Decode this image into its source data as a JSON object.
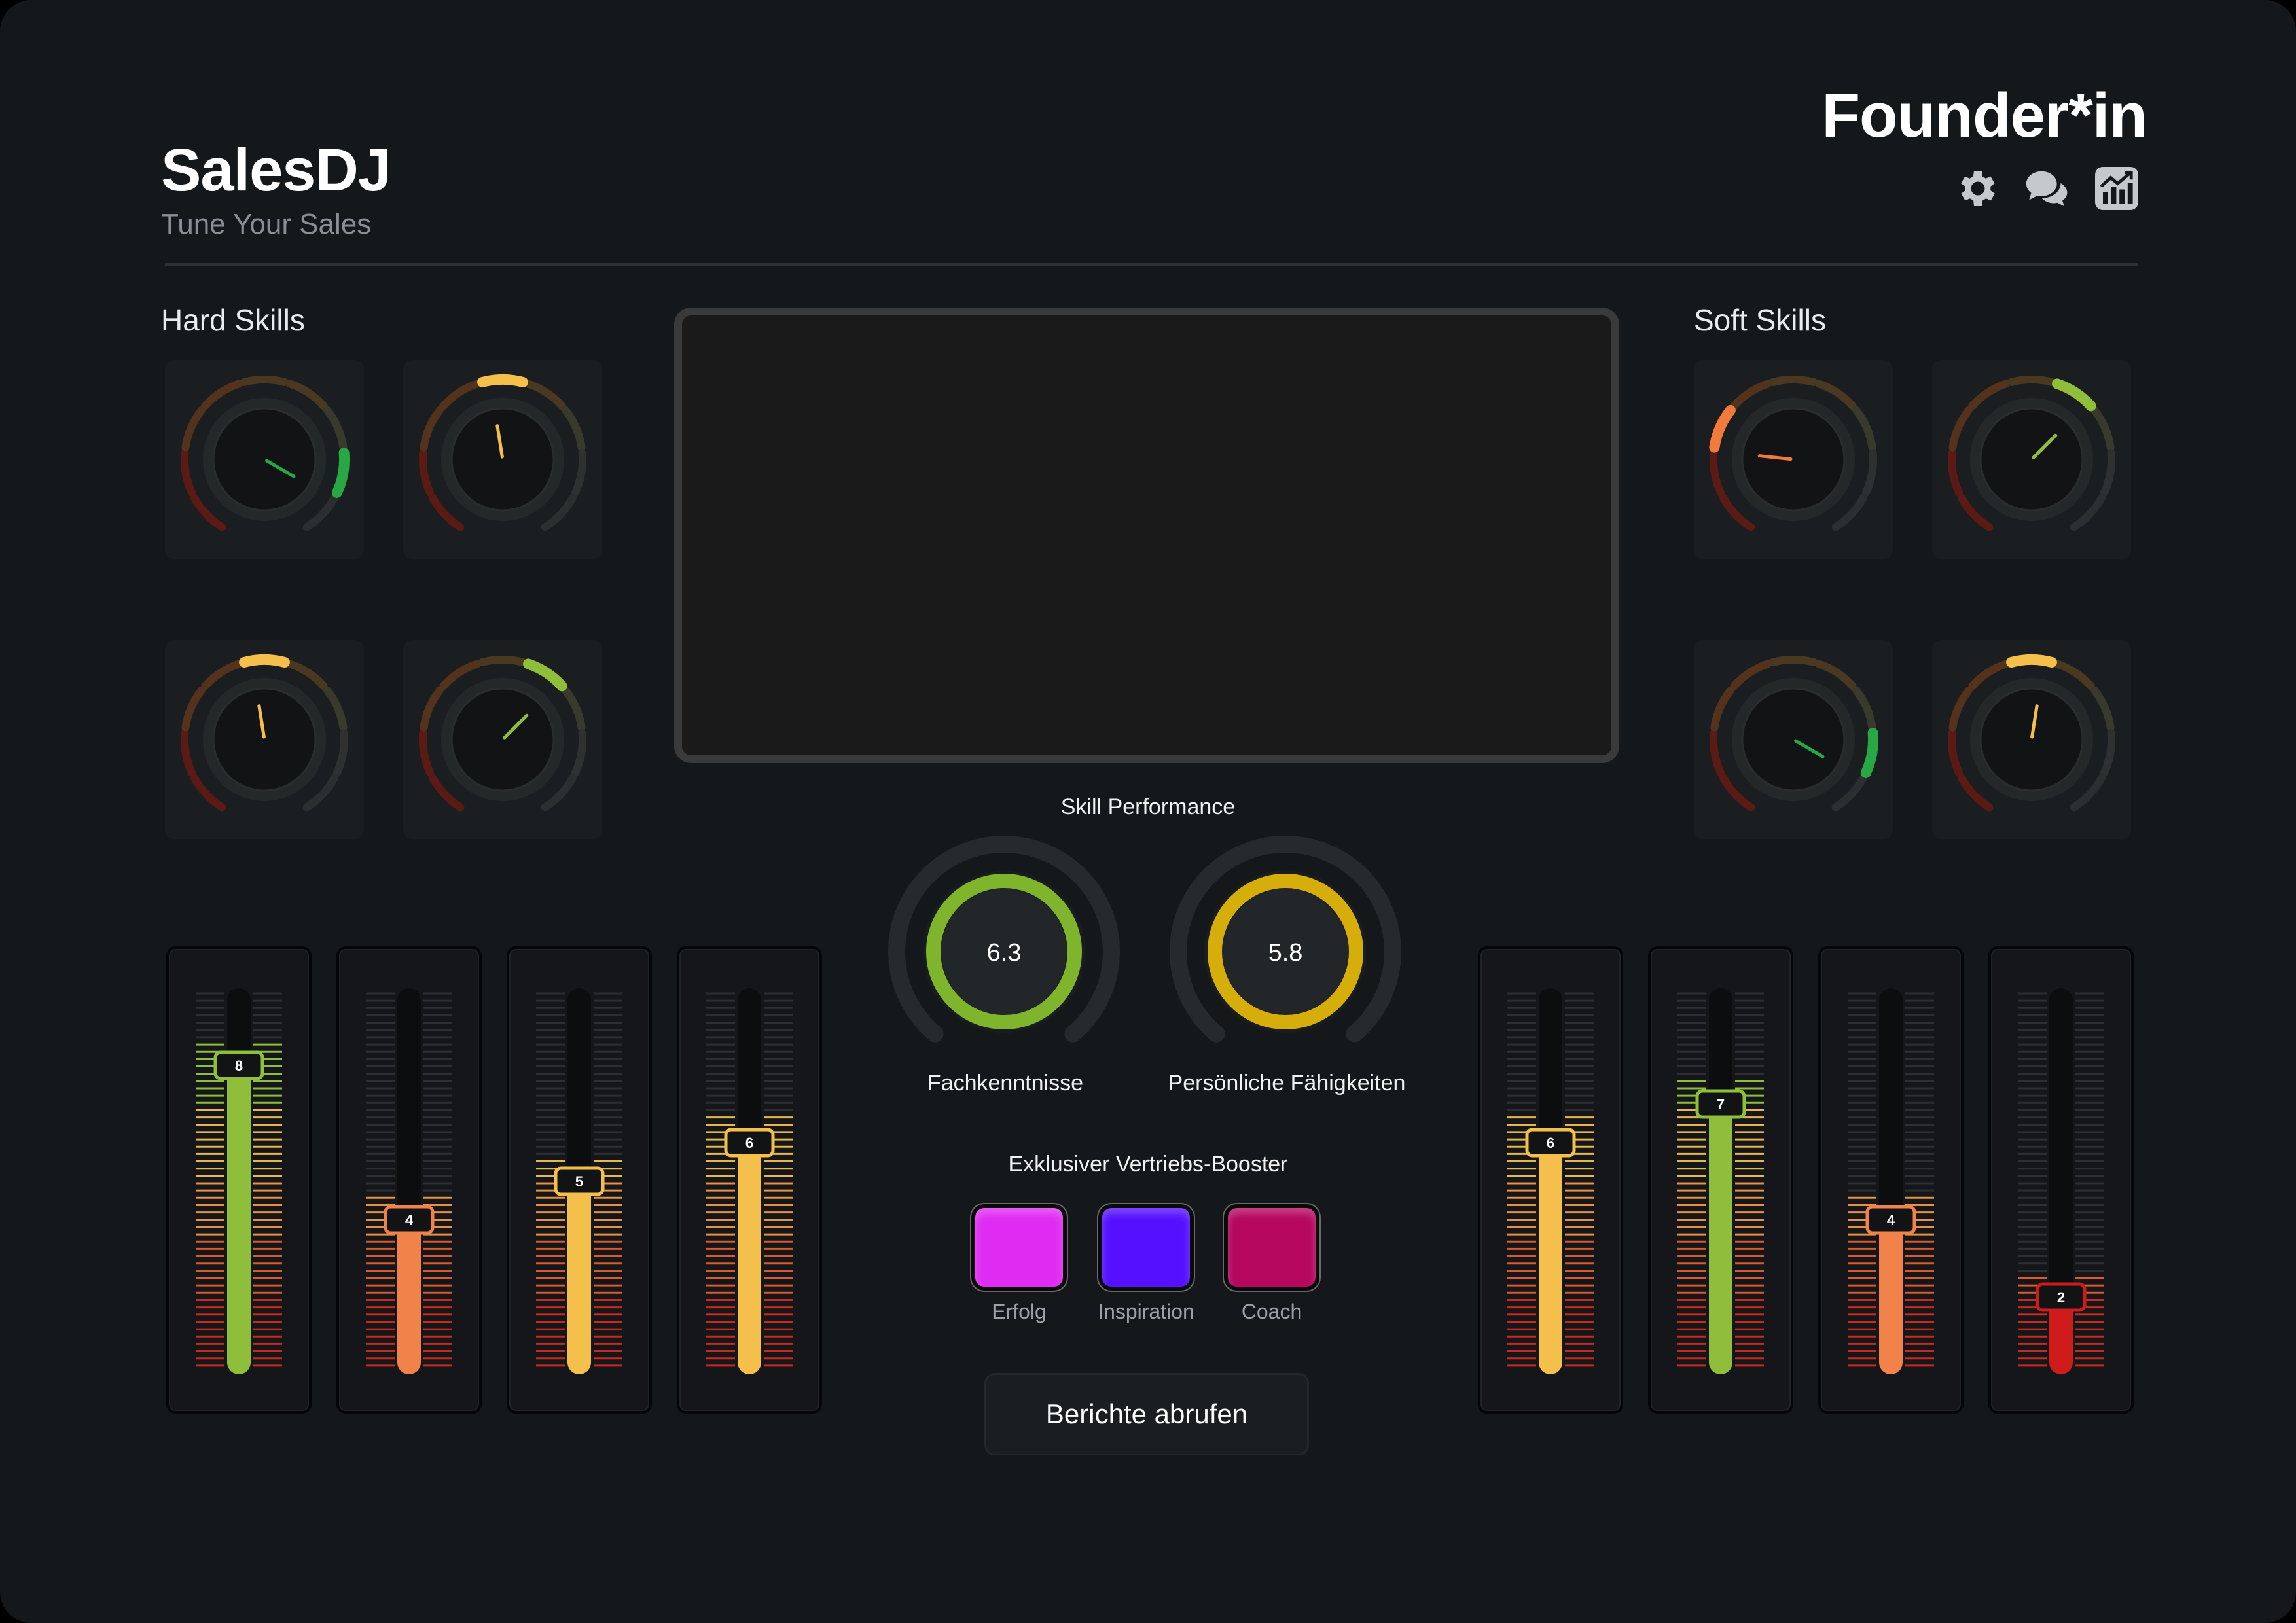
{
  "app": {
    "title": "SalesDJ",
    "subtitle": "Tune Your Sales",
    "role": "Founder*in"
  },
  "header_icons": [
    "gear-icon",
    "chat-icon",
    "chart-icon"
  ],
  "sections": {
    "hard_skills": "Hard Skills",
    "soft_skills": "Soft Skills"
  },
  "hard_knobs": [
    {
      "level": 0.9,
      "color": "#28a745"
    },
    {
      "level": 0.47,
      "color": "#f4c04b"
    },
    {
      "level": 0.47,
      "color": "#f4c04b"
    },
    {
      "level": 0.65,
      "color": "#8fbf3a"
    }
  ],
  "soft_knobs": [
    {
      "level": 0.22,
      "color": "#f27a3d"
    },
    {
      "level": 0.65,
      "color": "#8fbf3a"
    },
    {
      "level": 0.9,
      "color": "#28a745"
    },
    {
      "level": 0.53,
      "color": "#f4c04b"
    }
  ],
  "performance": {
    "title": "Skill Performance",
    "gauges": [
      {
        "value": "6.3",
        "label": "Fachkenntnisse",
        "color": "#7fb52d"
      },
      {
        "value": "5.8",
        "label": "Persönliche Fähigkeiten",
        "color": "#d6ae0b"
      }
    ]
  },
  "hard_faders": [
    {
      "value": "8",
      "level": 0.8,
      "color": "#8fbf3a"
    },
    {
      "value": "4",
      "level": 0.4,
      "color": "#f0824a"
    },
    {
      "value": "5",
      "level": 0.5,
      "color": "#f4c04b"
    },
    {
      "value": "6",
      "level": 0.6,
      "color": "#f4c04b"
    }
  ],
  "soft_faders": [
    {
      "value": "6",
      "level": 0.6,
      "color": "#f4c04b"
    },
    {
      "value": "7",
      "level": 0.7,
      "color": "#8fbf3a"
    },
    {
      "value": "4",
      "level": 0.4,
      "color": "#f0824a"
    },
    {
      "value": "2",
      "level": 0.2,
      "color": "#d01b1b"
    }
  ],
  "booster": {
    "title": "Exklusiver Vertriebs-Booster",
    "buttons": [
      {
        "label": "Erfolg",
        "color": "#e02cf2"
      },
      {
        "label": "Inspiration",
        "color": "#5410ff"
      },
      {
        "label": "Coach",
        "color": "#b5075e"
      }
    ]
  },
  "report_button": "Berichte abrufen"
}
